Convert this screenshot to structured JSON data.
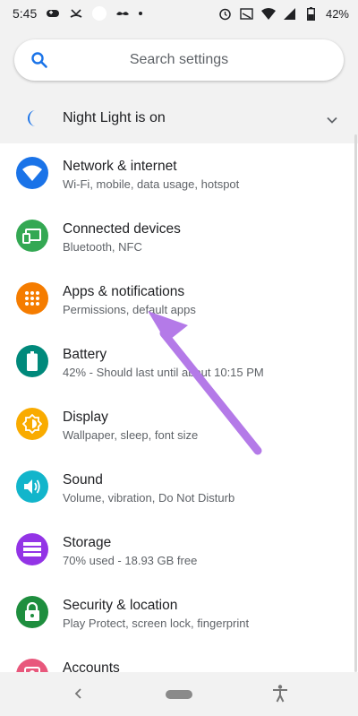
{
  "status_bar": {
    "time": "5:45",
    "battery_percent": "42%"
  },
  "search": {
    "placeholder": "Search settings"
  },
  "night_light": {
    "label": "Night Light is on"
  },
  "settings_items": [
    {
      "title": "Network & internet",
      "subtitle": "Wi-Fi, mobile, data usage, hotspot",
      "icon": "wifi-icon",
      "color": "#1a73e8"
    },
    {
      "title": "Connected devices",
      "subtitle": "Bluetooth, NFC",
      "icon": "devices-icon",
      "color": "#34a853"
    },
    {
      "title": "Apps & notifications",
      "subtitle": "Permissions, default apps",
      "icon": "apps-grid-icon",
      "color": "#f57c00"
    },
    {
      "title": "Battery",
      "subtitle": "42% - Should last until about 10:15 PM",
      "icon": "battery-icon",
      "color": "#00897b"
    },
    {
      "title": "Display",
      "subtitle": "Wallpaper, sleep, font size",
      "icon": "brightness-icon",
      "color": "#f9ab00"
    },
    {
      "title": "Sound",
      "subtitle": "Volume, vibration, Do Not Disturb",
      "icon": "volume-icon",
      "color": "#12b5cb"
    },
    {
      "title": "Storage",
      "subtitle": "70% used - 18.93 GB free",
      "icon": "storage-icon",
      "color": "#9334e6"
    },
    {
      "title": "Security & location",
      "subtitle": "Play Protect, screen lock, fingerprint",
      "icon": "lock-icon",
      "color": "#1e8e3e"
    },
    {
      "title": "Accounts",
      "subtitle": "",
      "icon": "account-icon",
      "color": "#e8587c"
    }
  ],
  "colors": {
    "accent": "#1a73e8",
    "arrow": "#b47ae8"
  }
}
